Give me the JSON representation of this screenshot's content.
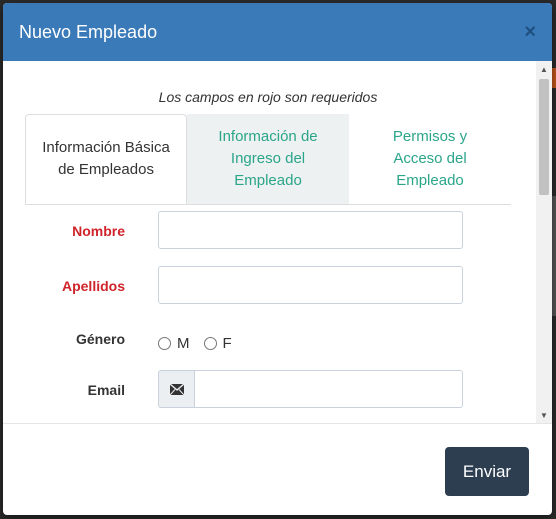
{
  "modal": {
    "title": "Nuevo Empleado",
    "close_glyph": "×"
  },
  "form": {
    "required_note": "Los campos en rojo son requeridos",
    "tabs": [
      {
        "label_line1": "Información Básica",
        "label_line2": "de Empleados",
        "label_line3": "",
        "active": true
      },
      {
        "label_line1": "Información de",
        "label_line2": "Ingreso del",
        "label_line3": "Empleado",
        "active": false
      },
      {
        "label_line1": "Permisos y",
        "label_line2": "Acceso del",
        "label_line3": "Empleado",
        "active": false
      }
    ],
    "fields": {
      "nombre": {
        "label": "Nombre",
        "value": "",
        "required": true
      },
      "apellidos": {
        "label": "Apellidos",
        "value": "",
        "required": true
      },
      "genero": {
        "label": "Género",
        "options": [
          "M",
          "F"
        ],
        "selected": null
      },
      "email": {
        "label": "Email",
        "value": "",
        "icon": "envelope-icon"
      }
    }
  },
  "footer": {
    "submit_label": "Enviar"
  },
  "colors": {
    "header_bg": "#3a7ab8",
    "required_label": "#d0242b",
    "tab_inactive_text": "#2aa58a",
    "submit_bg": "#2c3e50"
  }
}
